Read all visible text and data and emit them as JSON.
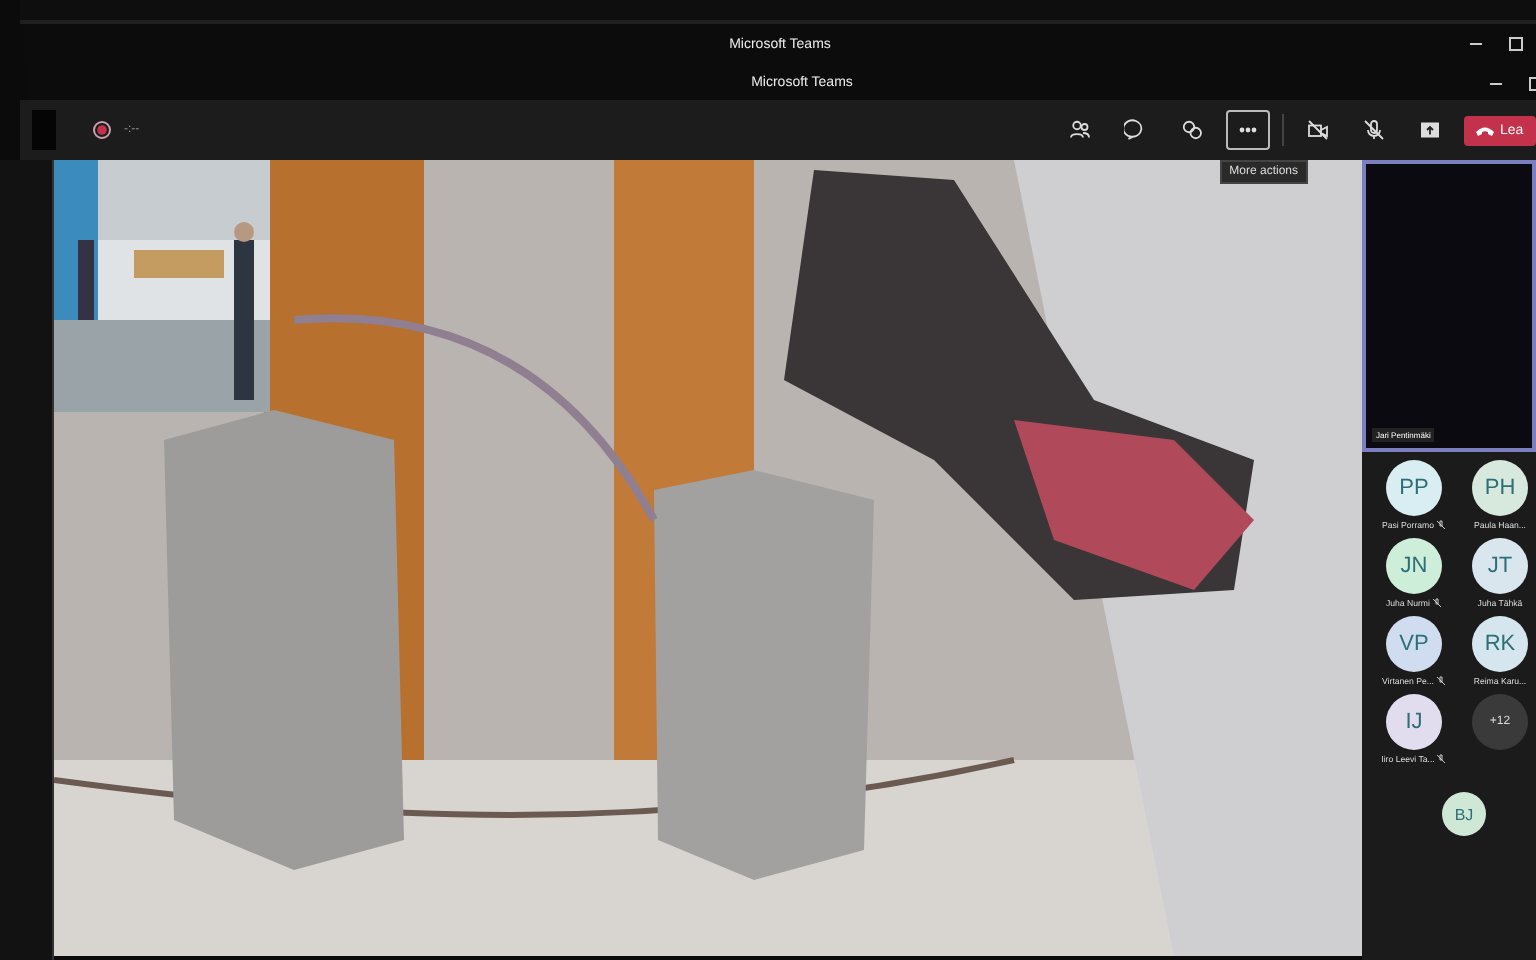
{
  "title_bars": [
    {
      "title": "Microsoft Teams"
    },
    {
      "title": "Microsoft Teams"
    }
  ],
  "toolbar": {
    "timer": "-:--",
    "tools": [
      {
        "kind": "people",
        "selected": false
      },
      {
        "kind": "chat",
        "selected": false
      },
      {
        "kind": "reactions",
        "selected": false
      },
      {
        "kind": "more",
        "selected": true
      },
      {
        "kind": "camera",
        "selected": false
      },
      {
        "kind": "mic",
        "selected": false
      },
      {
        "kind": "share",
        "selected": false
      }
    ],
    "tooltip": "More actions",
    "leave": "Lea"
  },
  "featured": {
    "name": "Jari Pentinmäki",
    "selected": true
  },
  "participants": [
    {
      "kind": "person",
      "initials": "PP",
      "name": "Pasi Porramo",
      "muted": true,
      "color": "#d8eef2"
    },
    {
      "kind": "person",
      "initials": "PH",
      "name": "Paula Haan...",
      "muted": false,
      "color": "#d7e8dc"
    },
    {
      "kind": "person",
      "initials": "JN",
      "name": "Juha Nurmi",
      "muted": true,
      "color": "#cdeed8"
    },
    {
      "kind": "person",
      "initials": "JT",
      "name": "Juha Tähkä",
      "muted": false,
      "color": "#d9e6ee"
    },
    {
      "kind": "person",
      "initials": "VP",
      "name": "Virtanen Pe...",
      "muted": true,
      "color": "#d0dcef"
    },
    {
      "kind": "person",
      "initials": "RK",
      "name": "Reima Karu...",
      "muted": false,
      "color": "#d6e6ee"
    },
    {
      "kind": "person",
      "initials": "IJ",
      "name": "Iiro Leevi Ta...",
      "muted": true,
      "color": "#e2dcef"
    },
    {
      "kind": "overflow",
      "initials": "+12"
    }
  ],
  "self": {
    "initials": "BJ",
    "color": "#cfe8d6"
  }
}
